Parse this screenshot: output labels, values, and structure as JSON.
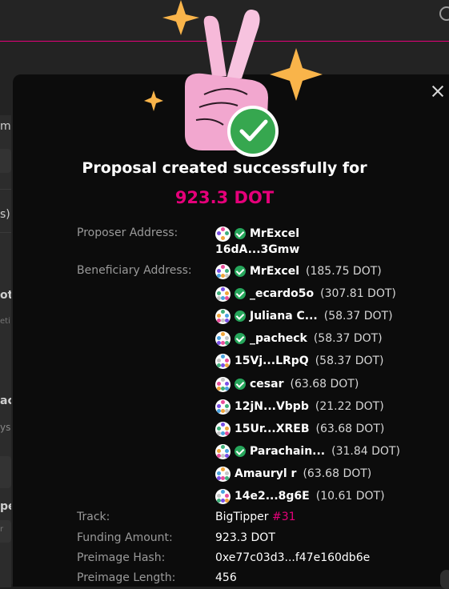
{
  "modal": {
    "title": "Proposal created successfully for",
    "amount": "923.3 DOT"
  },
  "proposer": {
    "label": "Proposer Address:",
    "name": "MrExcel",
    "address": "16dA...3Gmw"
  },
  "beneficiary": {
    "label": "Beneficiary Address:",
    "items": [
      {
        "name": "MrExcel",
        "balance": "(185.75 DOT)",
        "verified": true
      },
      {
        "name": "_ecardo5o",
        "balance": "(307.81 DOT)",
        "verified": true
      },
      {
        "name": "Juliana C...",
        "balance": "(58.37 DOT)",
        "verified": true
      },
      {
        "name": "_pacheck",
        "balance": "(58.37 DOT)",
        "verified": true
      },
      {
        "name": "15Vj...LRpQ",
        "balance": "(58.37 DOT)",
        "verified": false
      },
      {
        "name": "cesar",
        "balance": "(63.68 DOT)",
        "verified": true
      },
      {
        "name": "12jN...Vbpb",
        "balance": "(21.22 DOT)",
        "verified": false
      },
      {
        "name": "15Ur...XREB",
        "balance": "(63.68 DOT)",
        "verified": false
      },
      {
        "name": "Parachain...",
        "balance": "(31.84 DOT)",
        "verified": true
      },
      {
        "name": "Amauryl r",
        "balance": "(63.68 DOT)",
        "verified": false
      },
      {
        "name": "14e2...8g6E",
        "balance": "(10.61 DOT)",
        "verified": false
      }
    ]
  },
  "track": {
    "label": "Track:",
    "value": "BigTipper",
    "number": "#31"
  },
  "funding": {
    "label": "Funding Amount:",
    "value": "923.3 DOT"
  },
  "preimage_hash": {
    "label": "Preimage Hash:",
    "value": "0xe77c03d3...f47e160db6e"
  },
  "preimage_length": {
    "label": "Preimage Length:",
    "value": "456"
  },
  "background": {
    "fragments": [
      "m t",
      "s)",
      "ot",
      "eti",
      "ac",
      "ys",
      "pe",
      "r"
    ]
  },
  "colors": {
    "accent": "#e5007a",
    "verified": "#26a65b",
    "modal_bg": "#0c0c0c"
  }
}
